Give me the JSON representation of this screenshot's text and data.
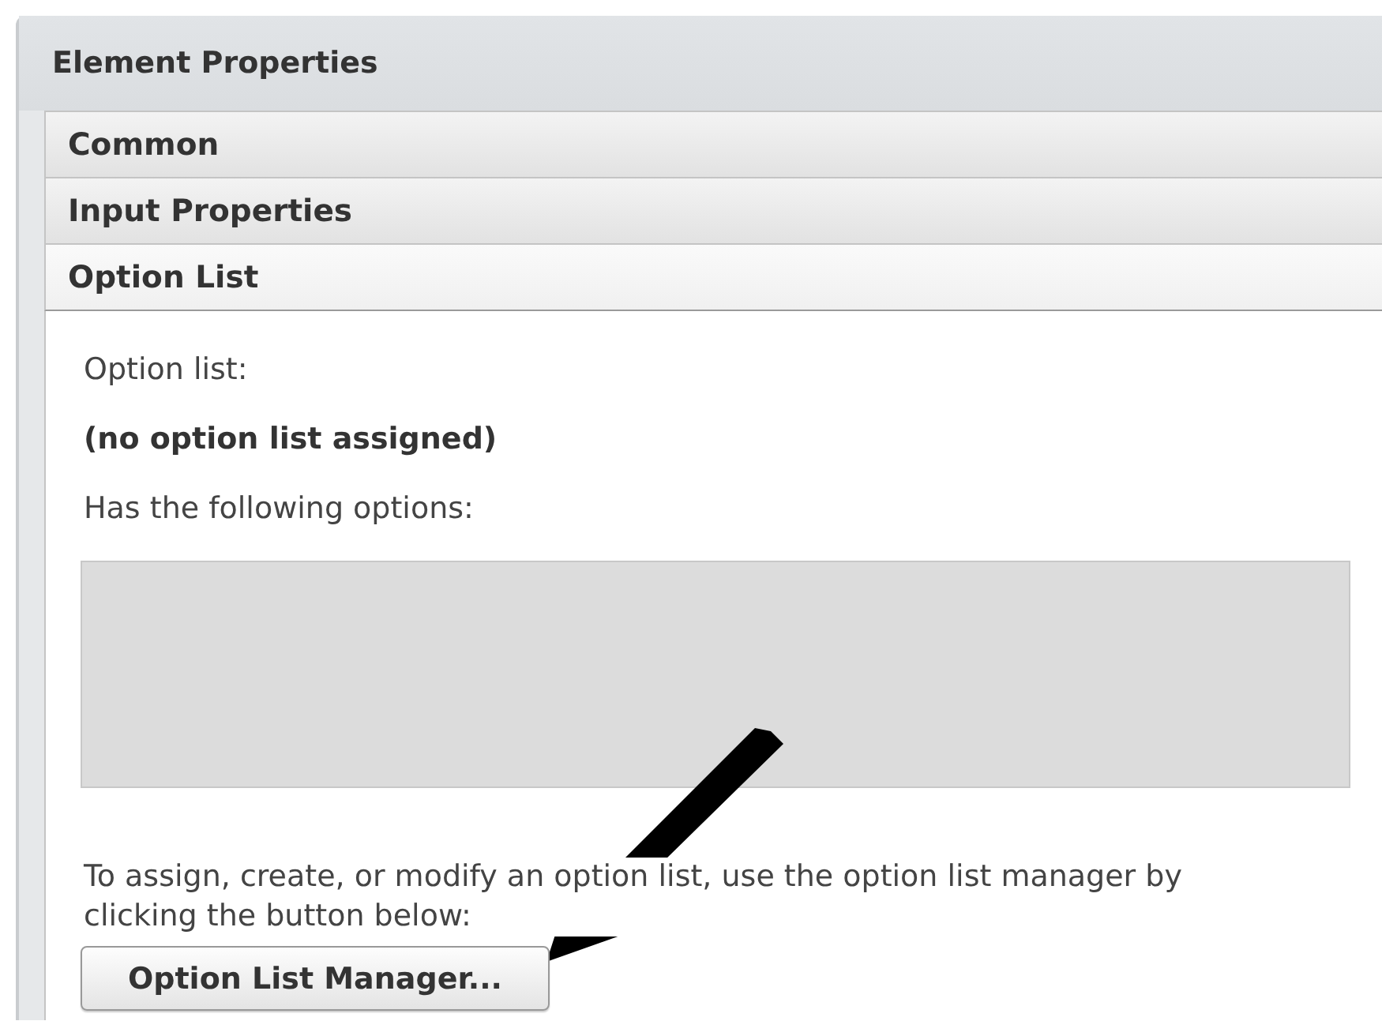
{
  "panel": {
    "title": "Element Properties"
  },
  "sections": [
    {
      "label": "Common",
      "selected": false
    },
    {
      "label": "Input Properties",
      "selected": false
    },
    {
      "label": "Option List",
      "selected": true
    }
  ],
  "option_list": {
    "label": "Option list:",
    "value": "(no option list assigned)",
    "options_label": "Has the following options:",
    "help": "To assign, create, or modify an option list, use the option list manager by clicking the button below:",
    "button": "Option List Manager..."
  }
}
